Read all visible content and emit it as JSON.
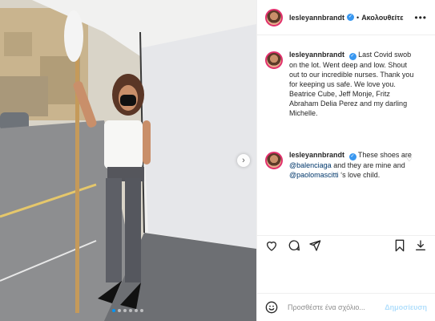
{
  "post": {
    "username": "lesleyannbrandt",
    "follow_label": "Ακολουθείτε",
    "separator": "•",
    "more_label": "•••",
    "caption": "Last Covid swob on the lot. Went deep and low. Shout out to our incredible nurses. Thank you for keeping us safe. We love you. Beatrice Cube, Jeff Monje, Fritz Abraham Delia Perez and my darling Michelle.",
    "comment": {
      "username": "lesleyannbrandt",
      "text_before": "These shoes are ",
      "mention1": "@balenciaga",
      "text_middle": " and they are mine and ",
      "mention2": "@paolomascitti",
      "text_after": " ‘s love child."
    }
  },
  "carousel": {
    "slide_count": 6,
    "active_index": 0
  },
  "icons": {
    "like": "heart-icon",
    "comment": "comment-icon",
    "share": "share-icon",
    "save": "bookmark-icon",
    "download": "download-icon",
    "emoji": "smiley-icon",
    "next": "chevron-right-icon"
  },
  "comment_box": {
    "placeholder": "Προσθέστε ένα σχόλιο...",
    "post_label": "Δημοσίευση"
  },
  "colors": {
    "verified": "#3897f0",
    "post_disabled": "#b2dffc",
    "mention": "#00376b"
  }
}
